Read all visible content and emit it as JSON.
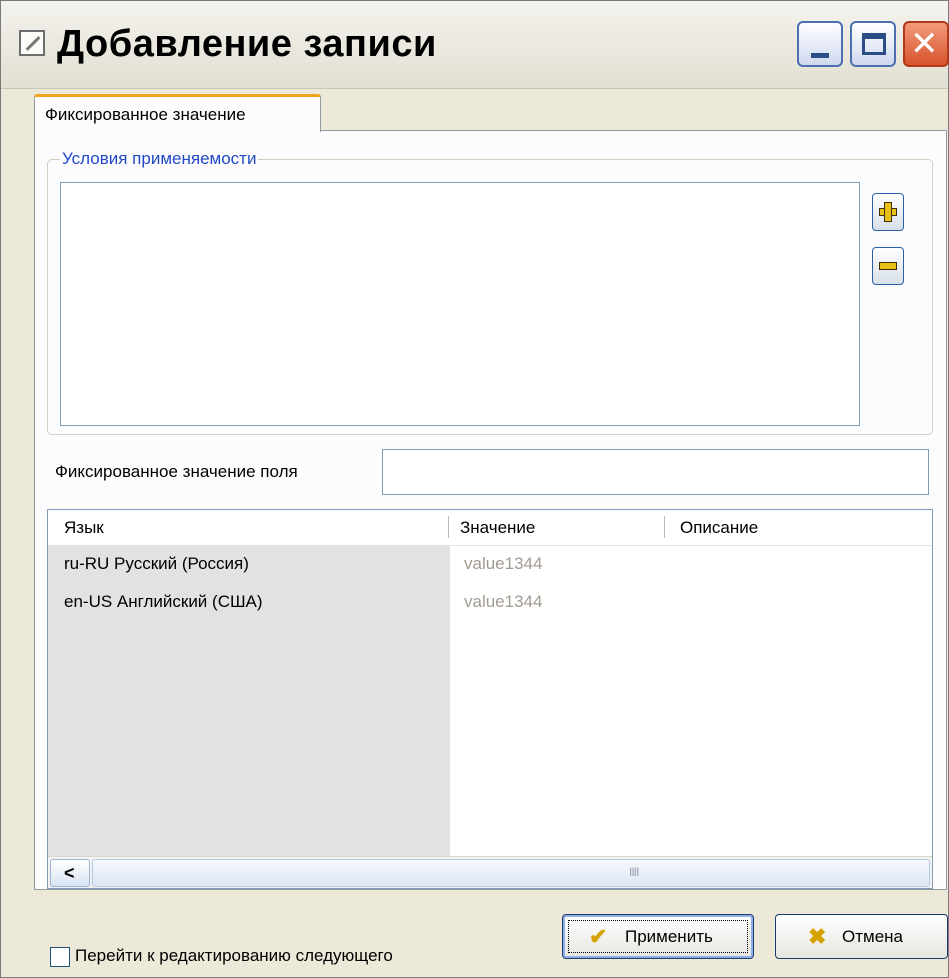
{
  "window": {
    "title": "Добавление записи",
    "title_icon": "edit-icon",
    "controls": [
      "minimize",
      "maximize",
      "close"
    ],
    "close_glyph": "✕"
  },
  "tab": {
    "label": "Фиксированное значение"
  },
  "conditions": {
    "legend": "Условия применяемости",
    "add_icon": "plus-icon",
    "remove_icon": "minus-icon"
  },
  "field": {
    "label": "Фиксированное значение поля",
    "value": ""
  },
  "grid": {
    "columns": [
      "Язык",
      "Значение",
      "Описание"
    ],
    "rows": [
      {
        "language": "ru-RU  Русский (Россия)",
        "value": "value1344",
        "description": ""
      },
      {
        "language": "en-US  Английский (США)",
        "value": "value1344",
        "description": ""
      }
    ],
    "scroll_left_glyph": "<",
    "scroll_grip": "IIII"
  },
  "footer": {
    "checkbox_label": "Перейти к редактированию следующего",
    "checkbox_checked": false,
    "apply_label": "Применить",
    "apply_icon": "checkmark-icon",
    "cancel_label": "Отмена",
    "cancel_icon": "cross-icon",
    "apply_glyph": "✔",
    "cancel_glyph": "✖"
  },
  "colors": {
    "tab_accent": "#f0a41c",
    "legend_text": "#2149c7",
    "placeholder_value": "#a19c8f",
    "language_column_bg": "#e2e2e5"
  }
}
